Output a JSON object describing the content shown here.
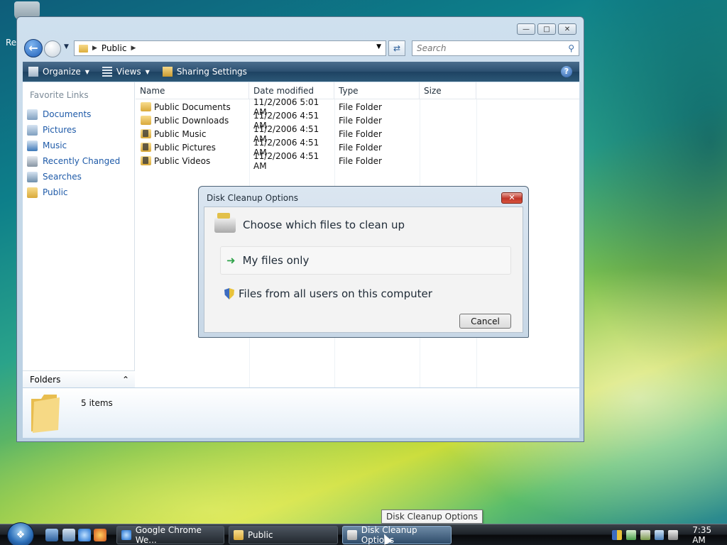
{
  "desktop": {
    "label": "Re"
  },
  "explorer": {
    "address": {
      "path_segment": "Public"
    },
    "search": {
      "placeholder": "Search"
    },
    "toolbar": {
      "organize_label": "Organize",
      "views_label": "Views",
      "sharing_label": "Sharing Settings"
    },
    "nav_pane": {
      "title": "Favorite Links",
      "items": [
        {
          "label": "Documents",
          "icon": "documents-icon"
        },
        {
          "label": "Pictures",
          "icon": "pictures-icon"
        },
        {
          "label": "Music",
          "icon": "music-icon"
        },
        {
          "label": "Recently Changed",
          "icon": "recently-changed-icon"
        },
        {
          "label": "Searches",
          "icon": "searches-icon"
        },
        {
          "label": "Public",
          "icon": "folder-icon"
        }
      ],
      "folders_label": "Folders"
    },
    "columns": {
      "name": "Name",
      "date": "Date modified",
      "type": "Type",
      "size": "Size"
    },
    "files": [
      {
        "name": "Public Documents",
        "date": "11/2/2006 5:01 AM",
        "type": "File Folder"
      },
      {
        "name": "Public Downloads",
        "date": "11/2/2006 4:51 AM",
        "type": "File Folder"
      },
      {
        "name": "Public Music",
        "date": "11/2/2006 4:51 AM",
        "type": "File Folder"
      },
      {
        "name": "Public Pictures",
        "date": "11/2/2006 4:51 AM",
        "type": "File Folder"
      },
      {
        "name": "Public Videos",
        "date": "11/2/2006 4:51 AM",
        "type": "File Folder"
      }
    ],
    "details": {
      "count": "5 items"
    }
  },
  "dialog": {
    "title": "Disk Cleanup Options",
    "heading": "Choose which files to clean up",
    "option_mine": "My files only",
    "option_all": "Files from all users on this computer",
    "cancel_label": "Cancel"
  },
  "tooltip": {
    "text": "Disk Cleanup Options"
  },
  "taskbar": {
    "buttons": [
      {
        "label": "Google Chrome We..."
      },
      {
        "label": "Public"
      },
      {
        "label": "Disk Cleanup Options"
      }
    ],
    "clock": "7:35 AM"
  },
  "colors": {
    "link": "#1e5aa8",
    "toolbar": "#2b4f70",
    "close_red": "#c0362a"
  }
}
